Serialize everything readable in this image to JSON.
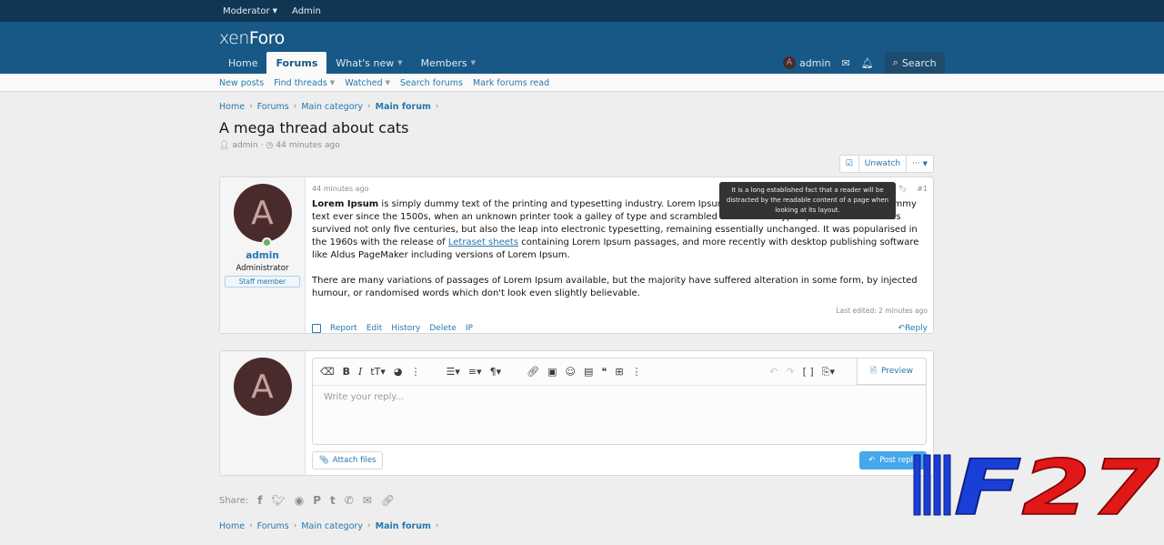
{
  "staffbar": {
    "moderator": "Moderator",
    "admin": "Admin"
  },
  "header": {
    "logo_a": "xen",
    "logo_b": "Foro",
    "nav": [
      {
        "label": "Home",
        "active": false,
        "caret": false
      },
      {
        "label": "Forums",
        "active": true,
        "caret": false
      },
      {
        "label": "What's new",
        "active": false,
        "caret": true
      },
      {
        "label": "Members",
        "active": false,
        "caret": true
      }
    ],
    "user": "admin",
    "user_initial": "A",
    "search": "Search"
  },
  "subnav": {
    "new_posts": "New posts",
    "find_threads": "Find threads",
    "watched": "Watched",
    "search_forums": "Search forums",
    "mark_read": "Mark forums read"
  },
  "breadcrumb": {
    "home": "Home",
    "forums": "Forums",
    "category": "Main category",
    "forum": "Main forum"
  },
  "thread": {
    "title": "A mega thread about cats",
    "author": "admin",
    "time": "44 minutes ago"
  },
  "watch": {
    "unwatch": "Unwatch",
    "more": "···"
  },
  "post": {
    "time": "44 minutes ago",
    "number": "#1",
    "author": "admin",
    "initial": "A",
    "user_title": "Administrator",
    "banner": "Staff member",
    "lead": "Lorem Ipsum",
    "p1a": " is simply dummy text of the printing and typesetting industry. Lorem Ipsum has been the industry's standard dummy text ever since the 1500s, when an unknown printer took a galley of type and scrambled it to make a type specimen book. It has survived not only five centuries, but also the leap into electronic typesetting, remaining essentially unchanged. It was popularised in the 1960s with the release of ",
    "link": "Letraset sheets",
    "p1b": " containing Lorem Ipsum passages, and more recently with desktop publishing software like Aldus PageMaker including versions of Lorem Ipsum.",
    "p2": "There are many variations of passages of Lorem Ipsum available, but the majority have suffered alteration in some form, by injected humour, or randomised words which don't look even slightly believable.",
    "edited": "Last edited: 2 minutes ago",
    "actions": {
      "report": "Report",
      "edit": "Edit",
      "history": "History",
      "delete": "Delete",
      "ip": "IP",
      "reply": "Reply"
    },
    "tooltip": "It is a long established fact that a reader will be distracted by the readable content of a page when looking at its layout."
  },
  "reply": {
    "initial": "A",
    "placeholder": "Write your reply...",
    "preview": "Preview",
    "attach": "Attach files",
    "post": "Post reply"
  },
  "share": {
    "label": "Share:"
  },
  "watermark": {
    "text": "F27"
  },
  "colors": {
    "header": "#185886",
    "staffbar": "#0f3652",
    "link": "#2577b1",
    "post_button": "#47a7eb"
  }
}
